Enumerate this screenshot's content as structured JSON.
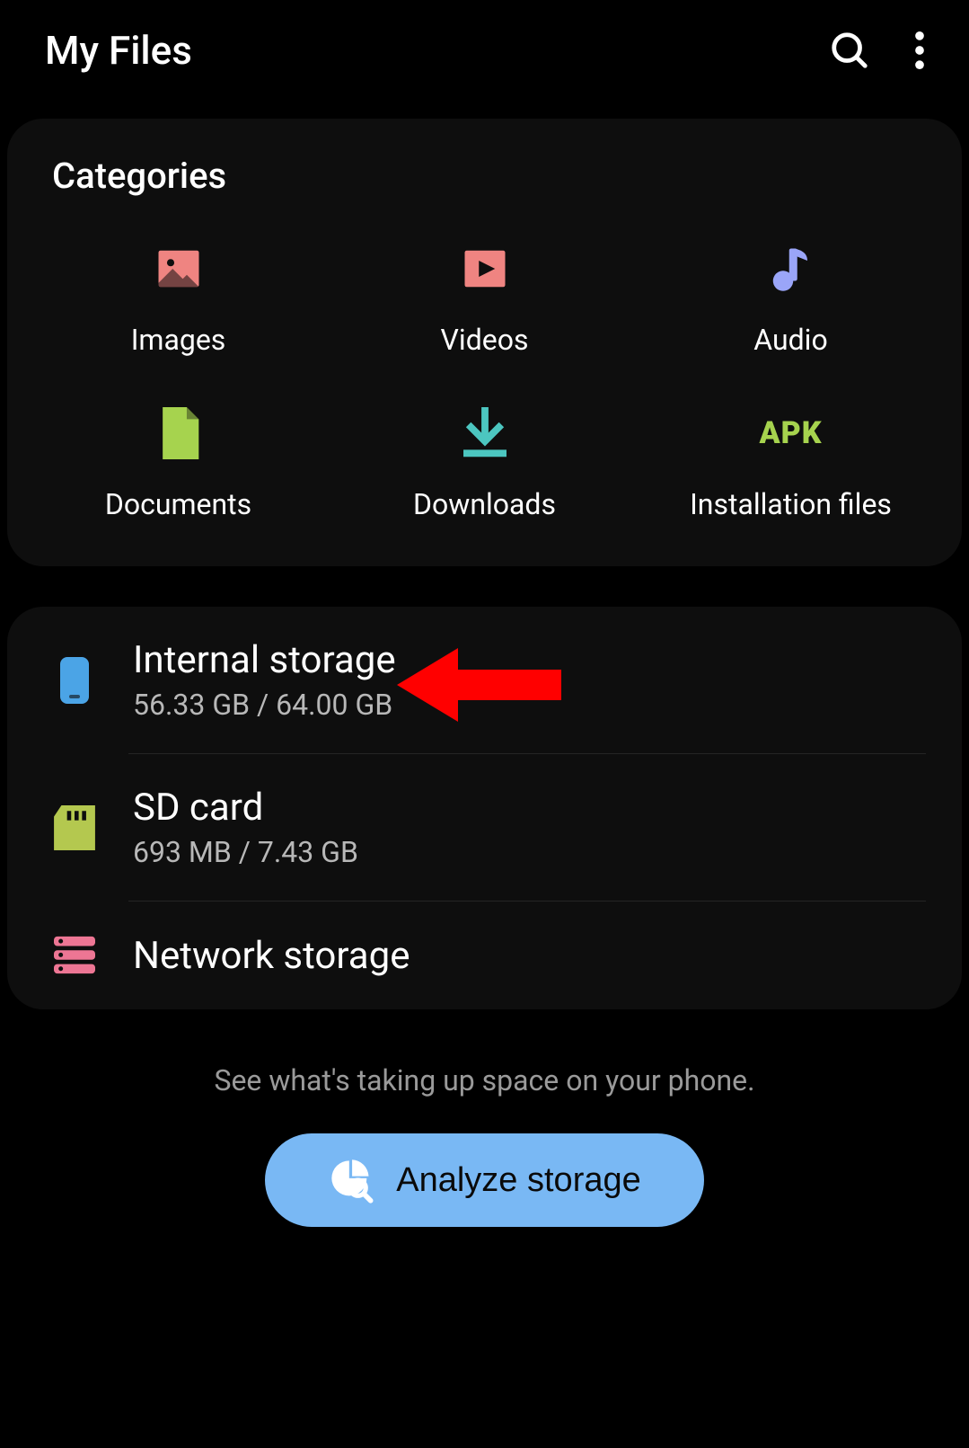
{
  "header": {
    "title": "My Files"
  },
  "categories": {
    "title": "Categories",
    "items": [
      {
        "label": "Images",
        "icon": "image-icon",
        "color": "#ef8481"
      },
      {
        "label": "Videos",
        "icon": "video-icon",
        "color": "#ef8481"
      },
      {
        "label": "Audio",
        "icon": "audio-icon",
        "color": "#9aa5f8"
      },
      {
        "label": "Documents",
        "icon": "document-icon",
        "color": "#a6d34e"
      },
      {
        "label": "Downloads",
        "icon": "download-icon",
        "color": "#4cc6c0"
      },
      {
        "label": "Installation files",
        "icon": "apk-icon",
        "color": "#a6d34e"
      }
    ]
  },
  "storage": {
    "items": [
      {
        "title": "Internal storage",
        "sub": "56.33 GB / 64.00 GB",
        "icon": "phone-icon",
        "color": "#4ba4e6"
      },
      {
        "title": "SD card",
        "sub": "693 MB / 7.43 GB",
        "icon": "sdcard-icon",
        "color": "#b4c84f"
      },
      {
        "title": "Network storage",
        "sub": "",
        "icon": "network-icon",
        "color": "#ed7694"
      }
    ]
  },
  "footer": {
    "hint": "See what's taking up space on your phone.",
    "analyze_label": "Analyze storage"
  },
  "annotation": {
    "arrow_color": "#ff0000"
  }
}
